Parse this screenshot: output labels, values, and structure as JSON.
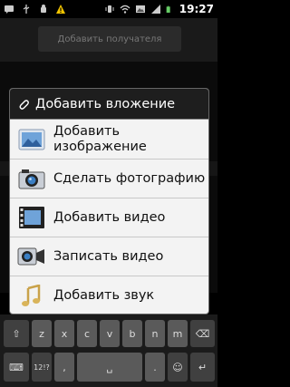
{
  "status_bar": {
    "time": "19:27",
    "icons": [
      "message-icon",
      "usb-icon",
      "android-debug-icon",
      "warning-icon",
      "vibrate-icon",
      "wifi-icon",
      "gallery-icon",
      "signal-icon",
      "battery-icon"
    ]
  },
  "header": {
    "recipient_placeholder": "Добавить получателя"
  },
  "dialog": {
    "title": "Добавить вложение",
    "items": [
      {
        "label": "Добавить изображение",
        "icon": "picture-icon"
      },
      {
        "label": "Сделать фотографию",
        "icon": "camera-icon"
      },
      {
        "label": "Добавить видео",
        "icon": "film-icon"
      },
      {
        "label": "Записать видео",
        "icon": "video-camera-icon"
      },
      {
        "label": "Добавить звук",
        "icon": "music-note-icon"
      }
    ]
  },
  "keyboard": {
    "row1": [
      "z",
      "x",
      "c",
      "v",
      "b",
      "n",
      "m"
    ],
    "row2_symbols_label": "12!?",
    "accent": "#5a5a5a"
  }
}
